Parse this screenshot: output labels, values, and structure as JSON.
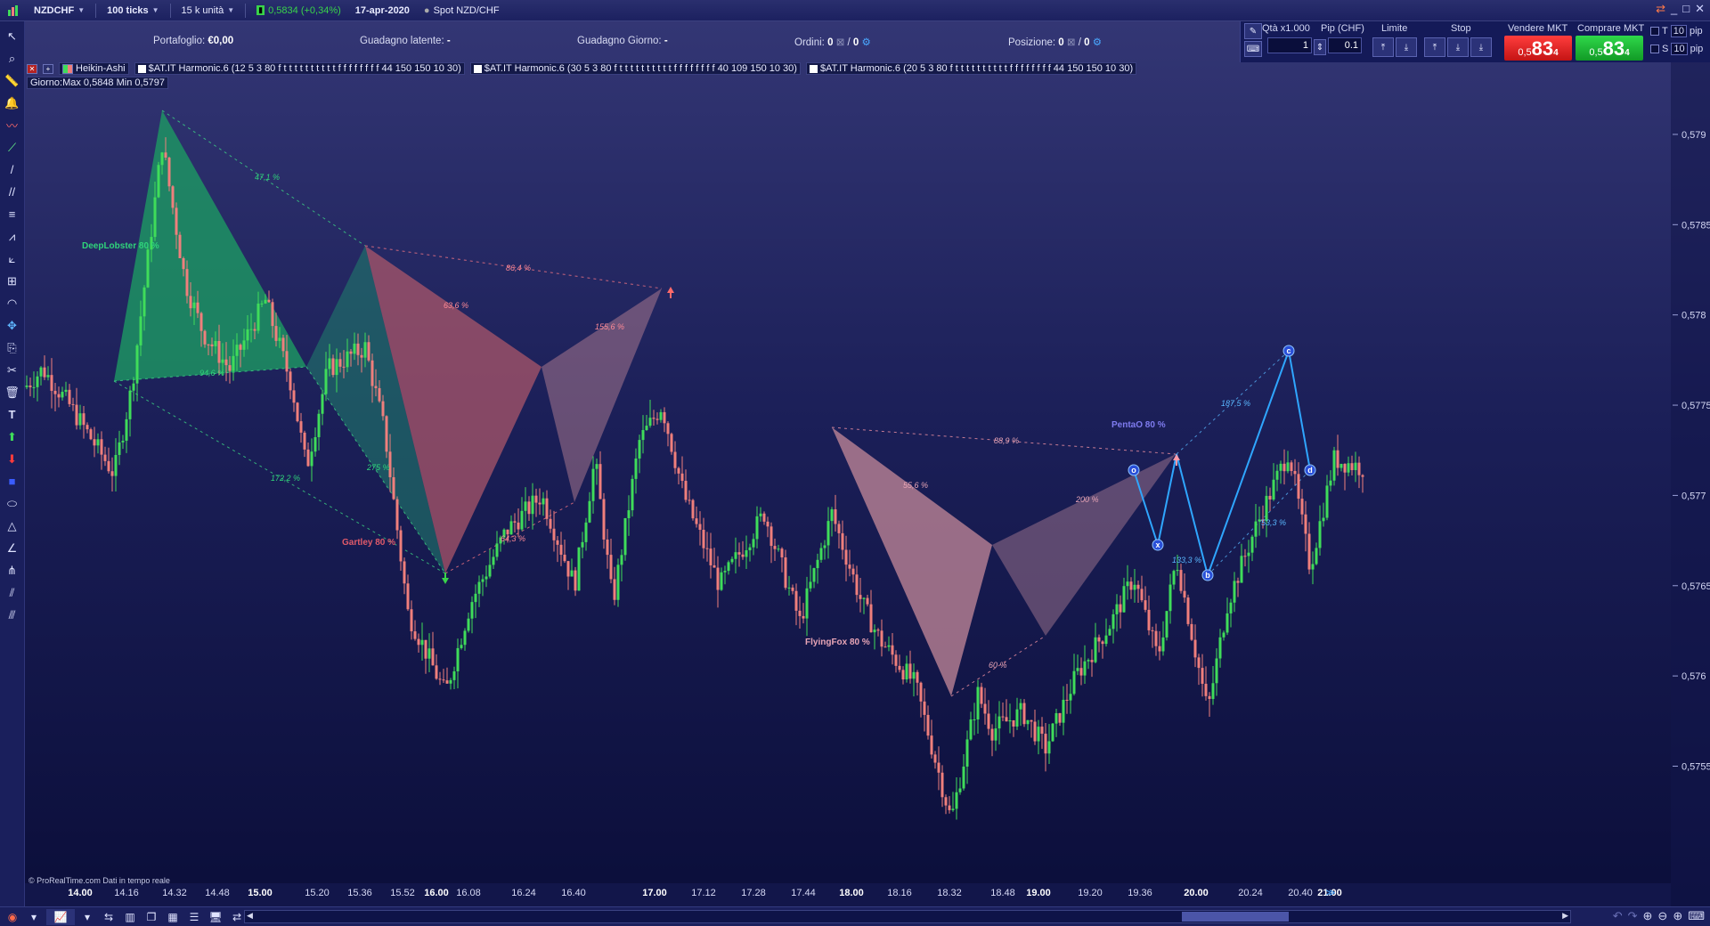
{
  "titlebar": {
    "symbol": "NZDCHF",
    "ticks": "100 ticks",
    "units": "15 k unità",
    "price": "0,5834 (+0,34%)",
    "date": "17-apr-2020",
    "instrument": "Spot NZD/CHF"
  },
  "info": {
    "portfolio_label": "Portafoglio:",
    "portfolio_value": "€0,00",
    "latent_label": "Guadagno latente:",
    "latent_value": "-",
    "day_label": "Guadagno Giorno:",
    "day_value": "-",
    "orders_label": "Ordini:",
    "orders_value": "0",
    "orders_value2": "0",
    "position_label": "Posizione:",
    "position_value": "0",
    "position_value2": "0"
  },
  "trade": {
    "qty_label": "Qtà x1.000",
    "qty_value": "1",
    "pip_label": "Pip (CHF)",
    "pip_value": "0.1",
    "limit_label": "Limite",
    "stop_label": "Stop",
    "sell_label": "Vendere MKT",
    "buy_label": "Comprare MKT",
    "sell_prefix": "0,5",
    "sell_big": "83",
    "sell_sup": "4",
    "buy_prefix": "0,5",
    "buy_big": "83",
    "buy_sup": "4",
    "t_label": "T",
    "s_label": "S",
    "t_num": "10",
    "s_num": "10",
    "pip_word": "pip"
  },
  "indicators": {
    "ha": "Heikin-Ashi",
    "h1": "$AT.IT Harmonic.6 (12 5 3 80 f t t t t t t t t t t f f f f f f f f 44 150 150 10 30)",
    "h2": "$AT.IT Harmonic.6 (30 5 3 80 f t t t t t t t t t t f f f f f f f f 40 109 150 10 30)",
    "h3": "$AT.IT Harmonic.6 (20 5 3 80 f t t t t t t t t t t f f f f f f f f 44 150 150 10 30)"
  },
  "day_box": "Giorno:Max 0,5848 Min 0,5797",
  "patterns": {
    "p1": "DeepLobster 80 %",
    "p2": "Gartley 80 %",
    "p3": "FlyingFox 80 %",
    "p4": "PentaO 80 %"
  },
  "ratios": [
    "47,1 %",
    "172,2 %",
    "94,6 %",
    "275 %",
    "86,4 %",
    "63,6 %",
    "155,6 %",
    "64,3 %",
    "88,9 %",
    "55,6 %",
    "200 %",
    "60 %",
    "187,5 %",
    "133,3 %",
    "53,3 %"
  ],
  "point_labels": [
    "o",
    "x",
    "c",
    "b",
    "d"
  ],
  "credit": "© ProRealTime.com  Dati in tempo reale",
  "chart_data": {
    "type": "candlestick",
    "style": "Heikin-Ashi",
    "ylim": [
      0.57495,
      0.57935
    ],
    "y_ticks": [
      "0,579",
      "0,5785",
      "0,578",
      "0,5775",
      "0,577",
      "0,5765",
      "0,576",
      "0,5755"
    ],
    "x_ticks": [
      "14.00",
      "14.16",
      "14.32",
      "14.48",
      "15.00",
      "15.20",
      "15.36",
      "15.52",
      "16.00",
      "16.08",
      "16.24",
      "16.40",
      "17.00",
      "17.12",
      "17.28",
      "17.44",
      "18.00",
      "18.16",
      "18.32",
      "18.48",
      "19.00",
      "19.20",
      "19.36",
      "20.00",
      "20.24",
      "20.40",
      "21.00"
    ],
    "x_ticks_bold": [
      "14.00",
      "15.00",
      "16.00",
      "17.00",
      "18.00",
      "19.00",
      "20.00",
      "21.00"
    ],
    "colors": {
      "up": "#3fdc5a",
      "down": "#ef7f7c",
      "up_pattern": "#1f8a5b",
      "down_pattern": "#c2636f"
    }
  }
}
